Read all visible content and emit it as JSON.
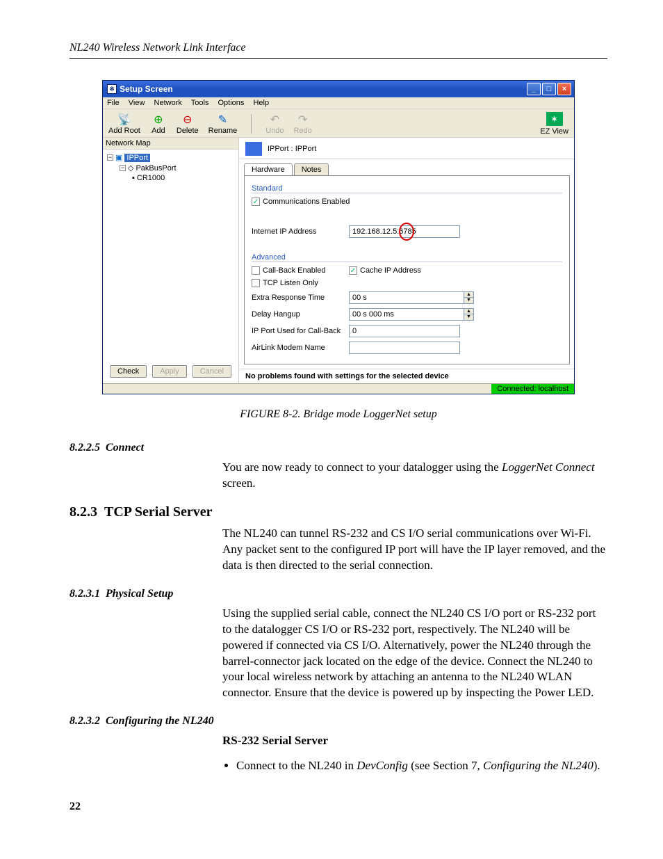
{
  "doc": {
    "header": "NL240 Wireless Network Link Interface",
    "page_num": "22",
    "figure_caption": "FIGURE 8-2.  Bridge mode LoggerNet setup",
    "s8225_num": "8.2.2.5",
    "s8225_title": "Connect",
    "s8225_body_a": "You are now ready to connect to your datalogger using the ",
    "s8225_body_b": "LoggerNet Connect",
    "s8225_body_c": " screen.",
    "s823_num": "8.2.3",
    "s823_title": "TCP Serial Server",
    "s823_body": "The NL240 can tunnel RS-232 and CS I/O serial communications over Wi-Fi. Any packet sent to the configured IP port will have the IP layer removed, and the data is then directed to the serial connection.",
    "s8231_num": "8.2.3.1",
    "s8231_title": "Physical Setup",
    "s8231_body": "Using the supplied serial cable, connect the NL240 CS I/O port or RS-232 port to the datalogger CS I/O or RS-232 port, respectively.  The NL240 will be powered if connected via CS I/O.  Alternatively, power the NL240 through the barrel-connector jack located on the edge of the device.  Connect the NL240 to your local wireless network by attaching an antenna to the NL240 WLAN connector.  Ensure that the device is powered up by inspecting the Power LED.",
    "s8232_num": "8.2.3.2",
    "s8232_title": "Configuring the NL240",
    "s8232_sub": "RS-232 Serial Server",
    "s8232_li_a": "Connect to the NL240 in ",
    "s8232_li_b": "DevConfig",
    "s8232_li_c": " (see Section 7, ",
    "s8232_li_d": "Configuring the NL240",
    "s8232_li_e": ")."
  },
  "w": {
    "title": "Setup Screen",
    "menu": {
      "file": "File",
      "view": "View",
      "network": "Network",
      "tools": "Tools",
      "options": "Options",
      "help": "Help"
    },
    "tb": {
      "addroot": "Add Root",
      "add": "Add",
      "delete": "Delete",
      "rename": "Rename",
      "undo": "Undo",
      "redo": "Redo",
      "ez": "EZ View"
    },
    "side_h": "Network Map",
    "tree": {
      "ipport": "IPPort",
      "pakbus": "PakBusPort",
      "cr1000": "CR1000"
    },
    "btns": {
      "check": "Check",
      "apply": "Apply",
      "cancel": "Cancel"
    },
    "main_title": "IPPort : IPPort",
    "tabs": {
      "hw": "Hardware",
      "notes": "Notes"
    },
    "grp_std": "Standard",
    "comm_en": "Communications Enabled",
    "ip_lbl": "Internet IP Address",
    "ip_val": "192.168.12.5:6785",
    "grp_adv": "Advanced",
    "callback": "Call-Back Enabled",
    "cache": "Cache IP Address",
    "tcplisten": "TCP Listen Only",
    "extra_lbl": "Extra Response Time",
    "extra_val": "00 s",
    "delay_lbl": "Delay Hangup",
    "delay_val": "00 s 000 ms",
    "ipport_lbl": "IP Port Used for Call-Back",
    "ipport_val": "0",
    "airlink_lbl": "AirLink Modem Name",
    "airlink_val": "",
    "status": "No problems found with settings for the selected device",
    "conn": "Connected: localhost"
  }
}
